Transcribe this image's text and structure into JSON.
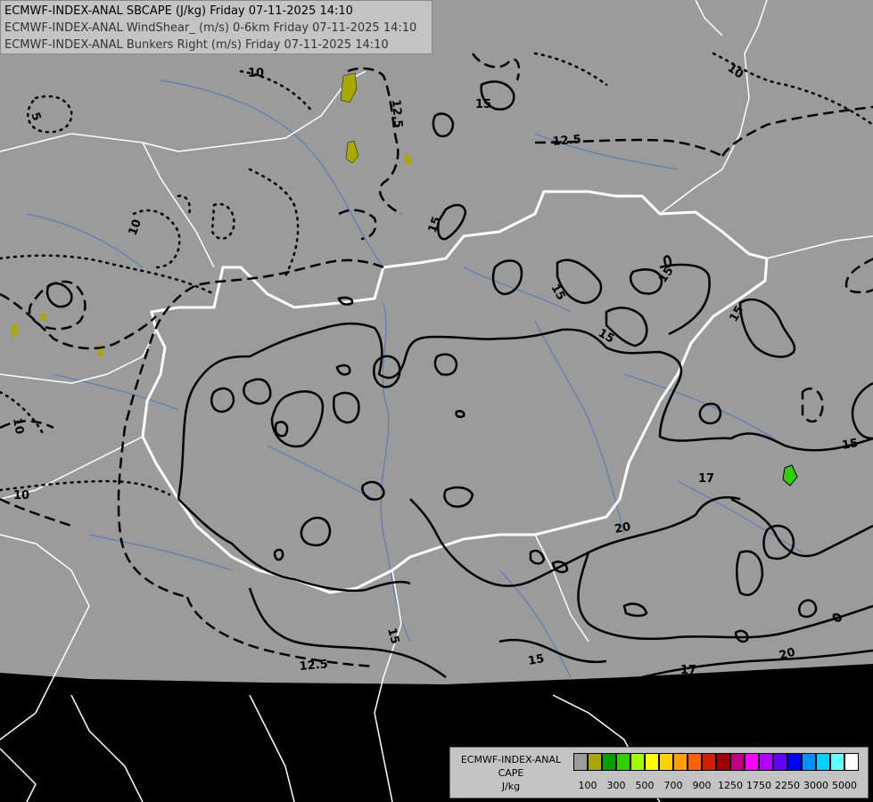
{
  "header": {
    "line1": "ECMWF-INDEX-ANAL SBCAPE (J/kg) Friday 07-11-2025 14:10",
    "line2": "ECMWF-INDEX-ANAL WindShear_ (m/s) 0-6km Friday 07-11-2025 14:10",
    "line3": "ECMWF-INDEX-ANAL Bunkers Right (m/s) Friday 07-11-2025 14:10"
  },
  "contour_labels": {
    "l10a": "10",
    "l10b": "10",
    "l10c": "10",
    "l10d": "10",
    "l10e": "10",
    "l125a": "12.5",
    "l125b": "12.5",
    "l125c": "12.5",
    "l15a": "15",
    "l15b": "15",
    "l15c": "15",
    "l15d": "15",
    "l15e": "15",
    "l15f": "15",
    "l15g": "15",
    "l15h": "15",
    "l17a": "17",
    "l17b": "17",
    "l20a": "20",
    "l20b": "20",
    "l5a": "5"
  },
  "legend": {
    "title_line1": "ECMWF-INDEX-ANAL",
    "title_line2": "CAPE",
    "title_line3": "J/kg",
    "colors": [
      "#9b9b9b",
      "#a8a800",
      "#00a000",
      "#30d000",
      "#a0ff00",
      "#ffff00",
      "#ffd000",
      "#ffa000",
      "#ff6000",
      "#d02000",
      "#a00000",
      "#c00080",
      "#ff00ff",
      "#b000ff",
      "#6000ff",
      "#0000ff",
      "#0090ff",
      "#00d0ff",
      "#60ffff",
      "#ffffff"
    ],
    "tick_labels": [
      "100",
      "300",
      "500",
      "700",
      "900",
      "1250",
      "1750",
      "2250",
      "3000",
      "5000"
    ]
  }
}
